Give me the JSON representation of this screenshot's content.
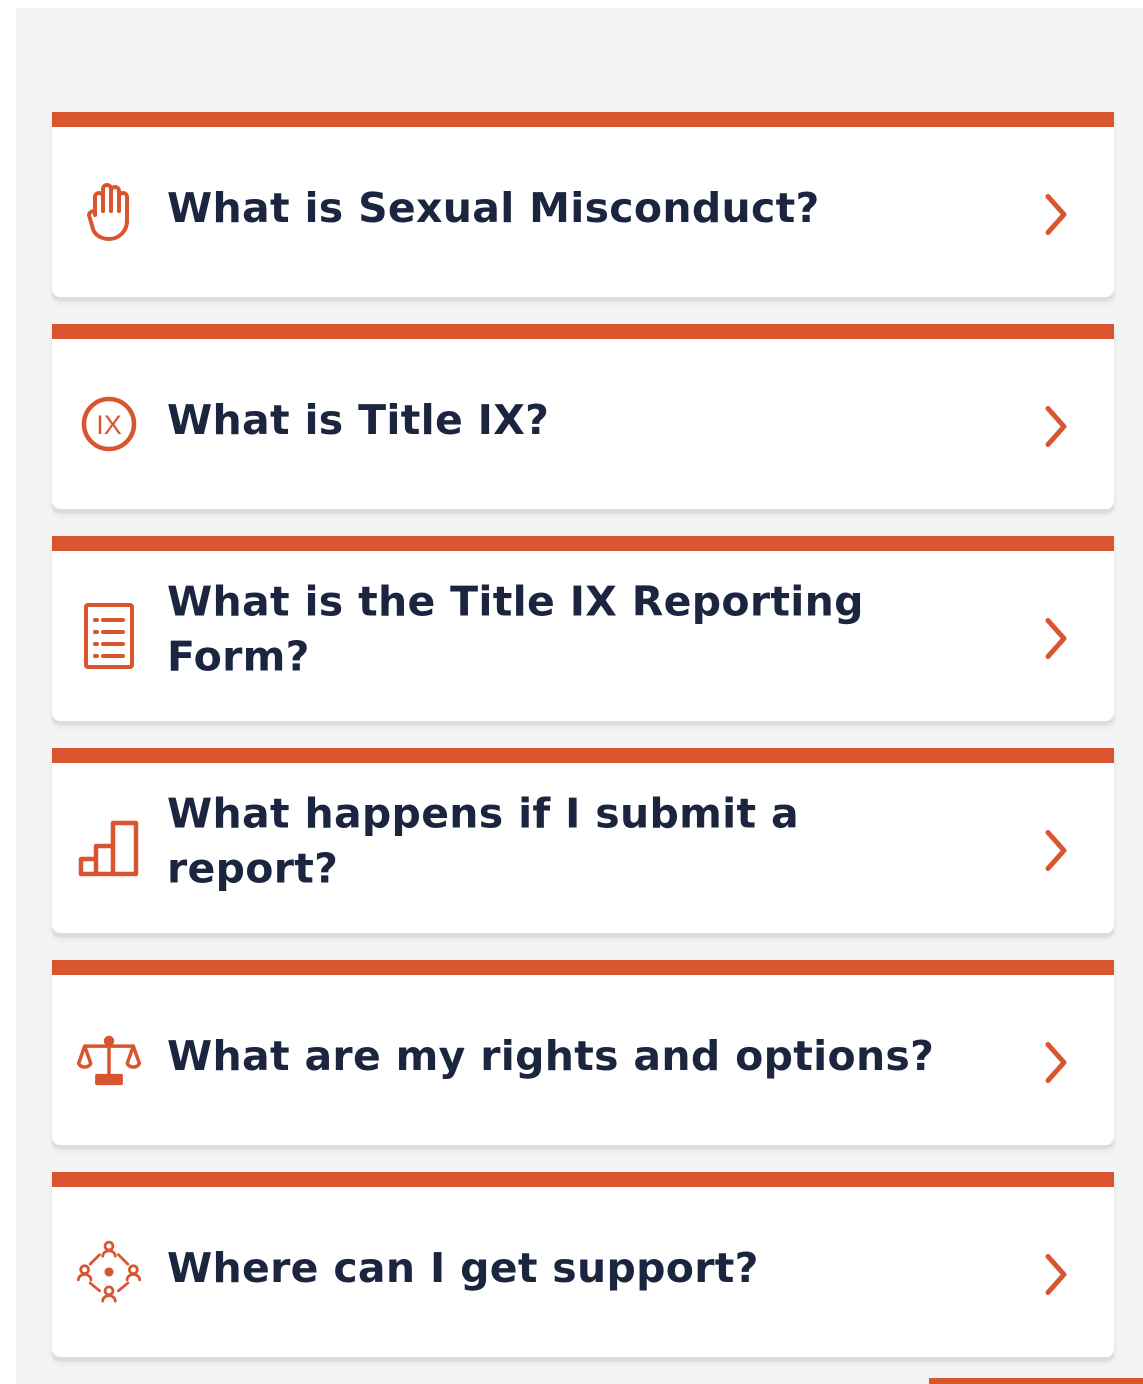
{
  "colors": {
    "accent": "#d9552f",
    "text": "#1c2540",
    "background": "#f4f4f4",
    "card": "#ffffff"
  },
  "menu": {
    "items": [
      {
        "label": "What is Sexual Misconduct?",
        "icon": "raised-hand-icon"
      },
      {
        "label": "What is Title IX?",
        "icon": "title-ix-icon"
      },
      {
        "label": "What is the Title IX Reporting Form?",
        "icon": "checklist-form-icon"
      },
      {
        "label": "What happens if I submit a report?",
        "icon": "steps-icon"
      },
      {
        "label": "What are my rights and options?",
        "icon": "scales-icon"
      },
      {
        "label": "Where can I get support?",
        "icon": "support-network-icon"
      }
    ],
    "title_ix_icon_text": "IX"
  }
}
